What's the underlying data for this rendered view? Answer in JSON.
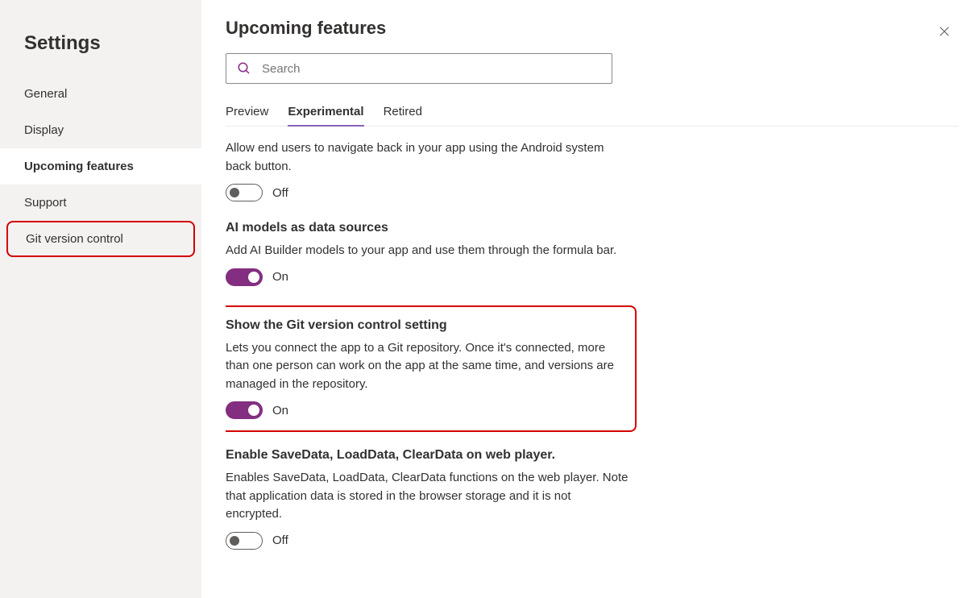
{
  "sidebar": {
    "title": "Settings",
    "items": [
      {
        "label": "General",
        "active": false,
        "highlighted": false
      },
      {
        "label": "Display",
        "active": false,
        "highlighted": false
      },
      {
        "label": "Upcoming features",
        "active": true,
        "highlighted": false
      },
      {
        "label": "Support",
        "active": false,
        "highlighted": false
      },
      {
        "label": "Git version control",
        "active": false,
        "highlighted": true
      }
    ]
  },
  "main": {
    "title": "Upcoming features",
    "search": {
      "placeholder": "Search"
    },
    "tabs": [
      {
        "label": "Preview",
        "active": false
      },
      {
        "label": "Experimental",
        "active": true
      },
      {
        "label": "Retired",
        "active": false
      }
    ],
    "toggle_labels": {
      "on": "On",
      "off": "Off"
    },
    "features": [
      {
        "title": "",
        "desc": "Allow end users to navigate back in your app using the Android system back button.",
        "on": false,
        "highlighted": false,
        "first": true
      },
      {
        "title": "AI models as data sources",
        "desc": "Add AI Builder models to your app and use them through the formula bar.",
        "on": true,
        "highlighted": false
      },
      {
        "title": "Show the Git version control setting",
        "desc": "Lets you connect the app to a Git repository. Once it's connected, more than one person can work on the app at the same time, and versions are managed in the repository.",
        "on": true,
        "highlighted": true
      },
      {
        "title": "Enable SaveData, LoadData, ClearData on web player.",
        "desc": "Enables SaveData, LoadData, ClearData functions on the web player. Note that application data is stored in the browser storage and it is not encrypted.",
        "on": false,
        "highlighted": false
      }
    ]
  }
}
